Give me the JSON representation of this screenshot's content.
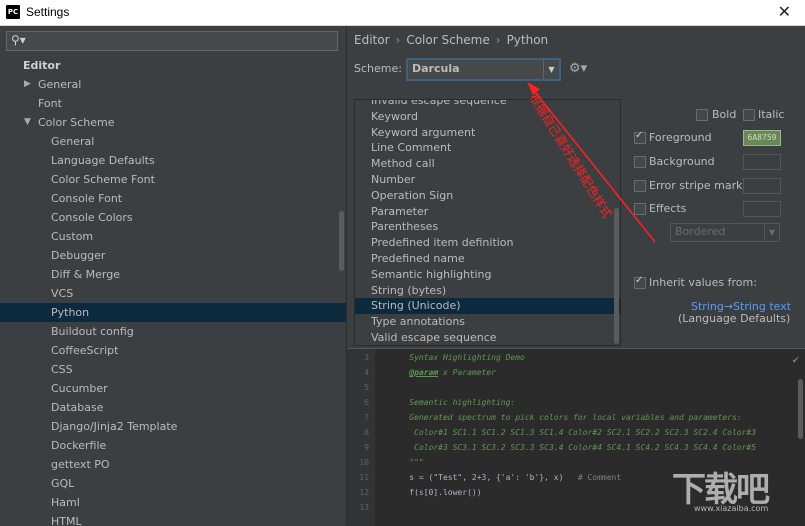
{
  "window": {
    "title": "Settings",
    "app_icon_text": "PC",
    "close_label": "✕"
  },
  "search": {
    "placeholder": "",
    "icon": "search-icon"
  },
  "tree": {
    "editor": "Editor",
    "general": "General",
    "font": "Font",
    "color_scheme": "Color Scheme",
    "children": [
      "General",
      "Language Defaults",
      "Color Scheme Font",
      "Console Font",
      "Console Colors",
      "Custom",
      "Debugger",
      "Diff & Merge",
      "VCS",
      "Python",
      "Buildout config",
      "CoffeeScript",
      "CSS",
      "Cucumber",
      "Database",
      "Django/Jinja2 Template",
      "Dockerfile",
      "gettext PO",
      "GQL",
      "Haml",
      "HTML"
    ],
    "selected": "Python"
  },
  "breadcrumb": {
    "items": [
      "Editor",
      "Color Scheme",
      "Python"
    ],
    "separator": "›"
  },
  "scheme": {
    "label": "Scheme:",
    "value": "Darcula"
  },
  "element_list": {
    "items": [
      "Invalid escape sequence",
      "Keyword",
      "Keyword argument",
      "Line Comment",
      "Method call",
      "Number",
      "Operation Sign",
      "Parameter",
      "Parentheses",
      "Predefined item definition",
      "Predefined name",
      "Semantic highlighting",
      "String (bytes)",
      "String (Unicode)",
      "Type annotations",
      "Valid escape sequence"
    ],
    "selected": "String (Unicode)"
  },
  "options": {
    "bold": "Bold",
    "italic": "Italic",
    "foreground": "Foreground",
    "foreground_value": "6A8759",
    "background": "Background",
    "error_stripe": "Error stripe mark",
    "effects": "Effects",
    "effects_type": "Bordered",
    "inherit": "Inherit values from:",
    "inherit_link": "String→String text",
    "inherit_source": "(Language Defaults)"
  },
  "preview": {
    "lines": [
      {
        "n": "3",
        "segments": [
          {
            "t": "    Syntax Highlighting Demo",
            "c": "c-doc"
          }
        ]
      },
      {
        "n": "4",
        "segments": [
          {
            "t": "    ",
            "c": "c-doc"
          },
          {
            "t": "@param",
            "c": "c-tag"
          },
          {
            "t": " x Parameter",
            "c": "c-doc"
          }
        ]
      },
      {
        "n": "5",
        "segments": [
          {
            "t": "",
            "c": "c-doc"
          }
        ]
      },
      {
        "n": "6",
        "segments": [
          {
            "t": "    Semantic highlighting:",
            "c": "c-doc"
          }
        ]
      },
      {
        "n": "7",
        "segments": [
          {
            "t": "    Generated spectrum to pick colors for local variables and parameters:",
            "c": "c-doc"
          }
        ]
      },
      {
        "n": "8",
        "segments": [
          {
            "t": "     Color#1 SC1.1 SC1.2 SC1.3 SC1.4 Color#2 SC2.1 SC2.2 SC2.3 SC2.4 Color#3",
            "c": "c-doc"
          }
        ]
      },
      {
        "n": "9",
        "segments": [
          {
            "t": "     Color#3 SC3.1 SC3.2 SC3.3 SC3.4 Color#4 SC4.1 SC4.2 SC4.3 SC4.4 Color#5",
            "c": "c-doc"
          }
        ]
      },
      {
        "n": "10",
        "segments": [
          {
            "t": "    \"\"\"",
            "c": "c-doc"
          }
        ]
      },
      {
        "n": "11",
        "segments": [
          {
            "t": "    s = (\"Test\", 2+3, {'a': 'b'}, x)   ",
            "c": "c-norm"
          },
          {
            "t": "# Comment",
            "c": "c-cmt"
          }
        ]
      },
      {
        "n": "12",
        "segments": [
          {
            "t": "    f(s[0].lower())",
            "c": "c-norm"
          }
        ]
      },
      {
        "n": "13",
        "segments": [
          {
            "t": "",
            "c": "c-norm"
          }
        ]
      }
    ]
  },
  "annotation": {
    "text": "根据自己喜好选择配色样式"
  },
  "watermark": {
    "text": "下载吧",
    "url": "www.xiazaiba.com"
  },
  "colors": {
    "selection": "#0d293e",
    "link": "#589df6",
    "annotation": "#ff2020"
  }
}
